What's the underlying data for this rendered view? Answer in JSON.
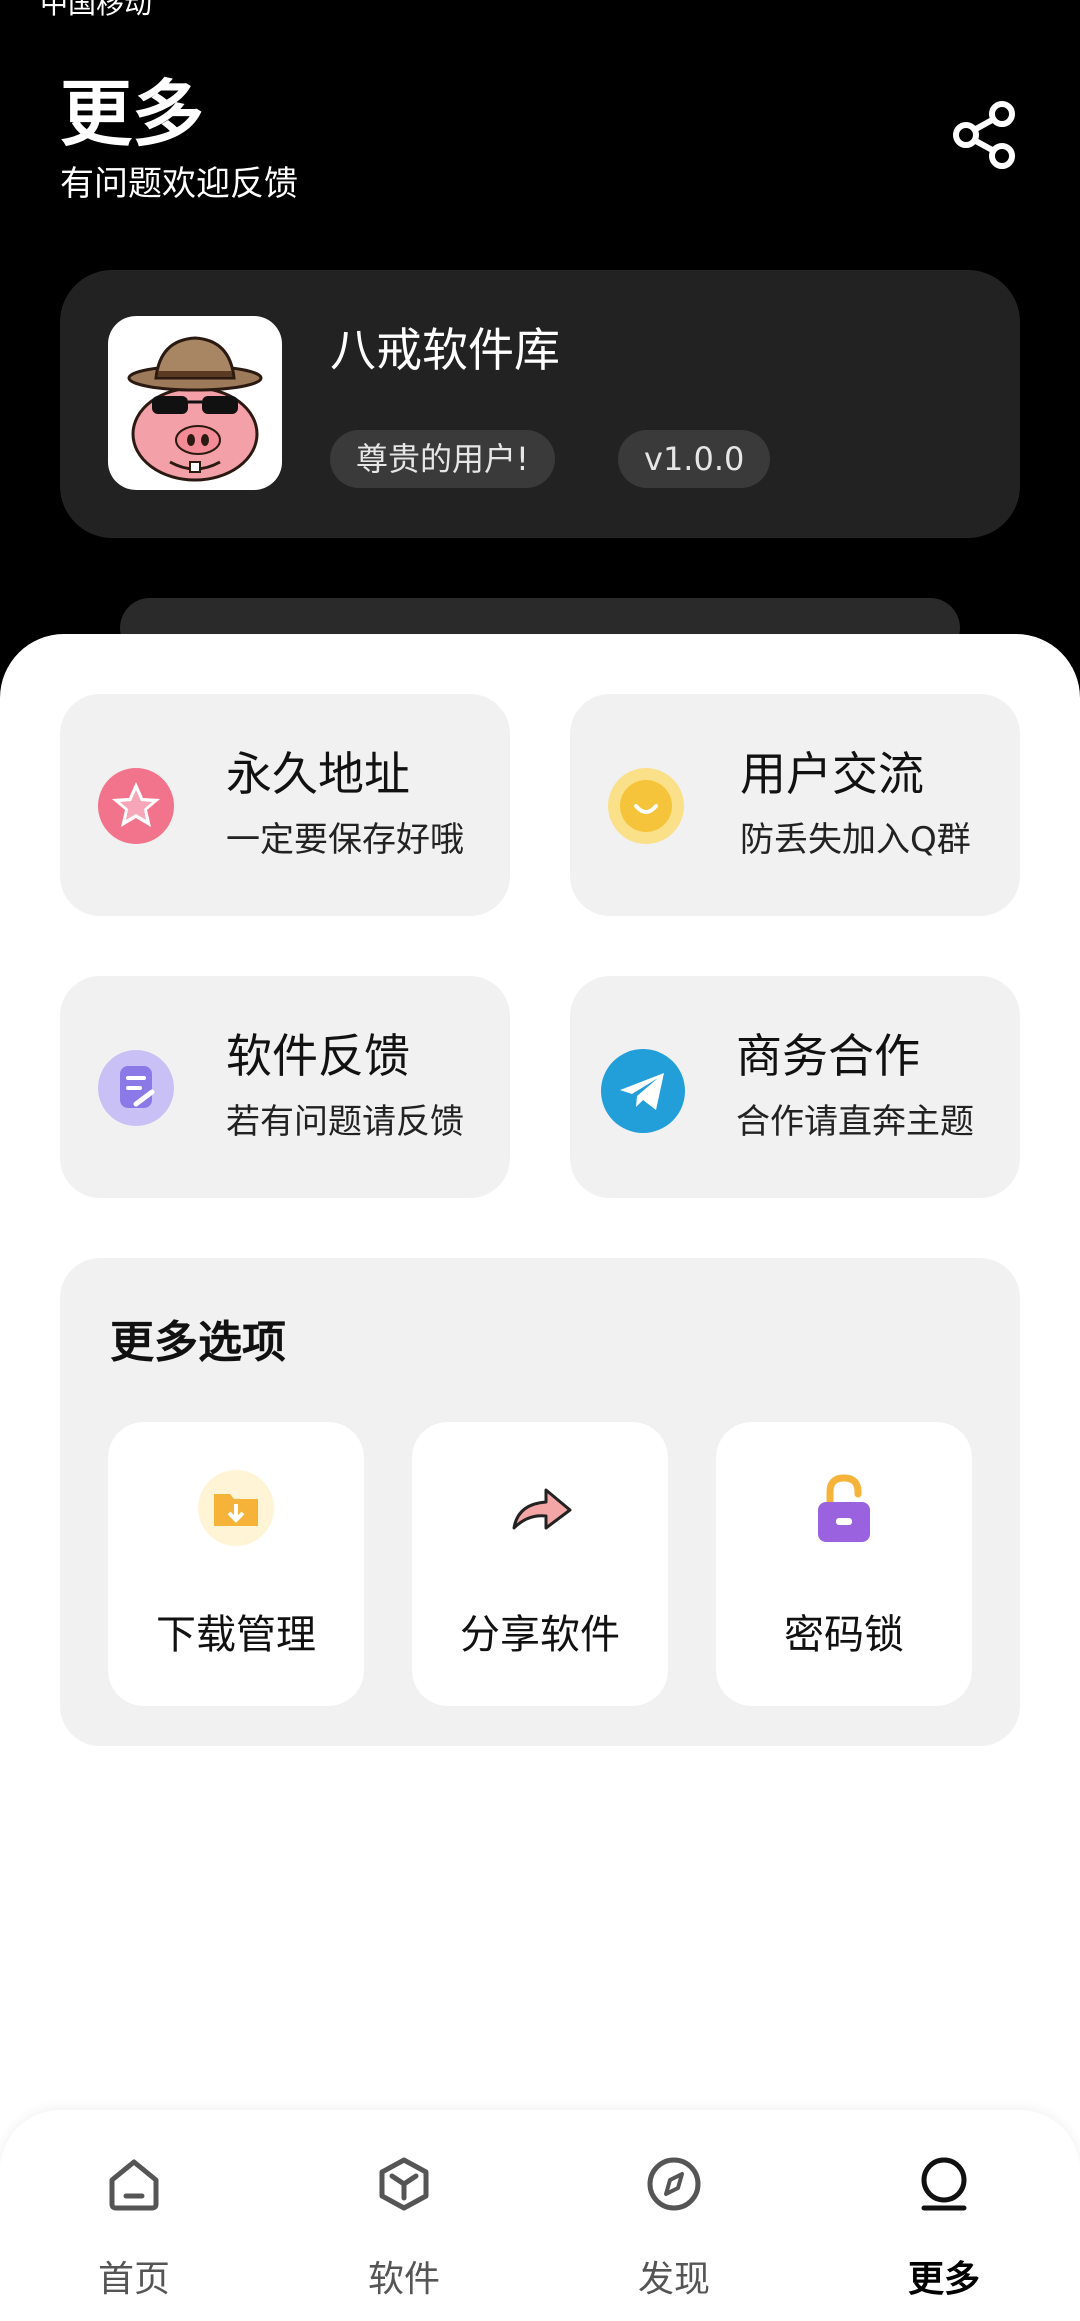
{
  "status": {
    "carrier": "中国移动"
  },
  "header": {
    "title": "更多",
    "subtitle": "有问题欢迎反馈"
  },
  "app": {
    "name": "八戒软件库",
    "user_badge": "尊贵的用户!",
    "version": "v1.0.0"
  },
  "tiles": [
    {
      "title": "永久地址",
      "subtitle": "一定要保存好哦",
      "icon": "star-icon",
      "color": "#f2748c"
    },
    {
      "title": "用户交流",
      "subtitle": "防丢失加入Q群",
      "icon": "chat-icon",
      "color": "#f5c43a"
    },
    {
      "title": "软件反馈",
      "subtitle": "若有问题请反馈",
      "icon": "feedback-icon",
      "color": "#8a79e6"
    },
    {
      "title": "商务合作",
      "subtitle": "合作请直奔主题",
      "icon": "telegram-icon",
      "color": "#229ed9"
    }
  ],
  "more": {
    "title": "更多选项",
    "options": [
      {
        "label": "下载管理",
        "icon": "download-folder-icon"
      },
      {
        "label": "分享软件",
        "icon": "share-arrow-icon"
      },
      {
        "label": "密码锁",
        "icon": "lock-icon"
      }
    ]
  },
  "tabbar": [
    {
      "label": "首页",
      "icon": "home-icon"
    },
    {
      "label": "软件",
      "icon": "cube-icon"
    },
    {
      "label": "发现",
      "icon": "compass-icon"
    },
    {
      "label": "更多",
      "icon": "profile-icon",
      "active": true
    }
  ]
}
